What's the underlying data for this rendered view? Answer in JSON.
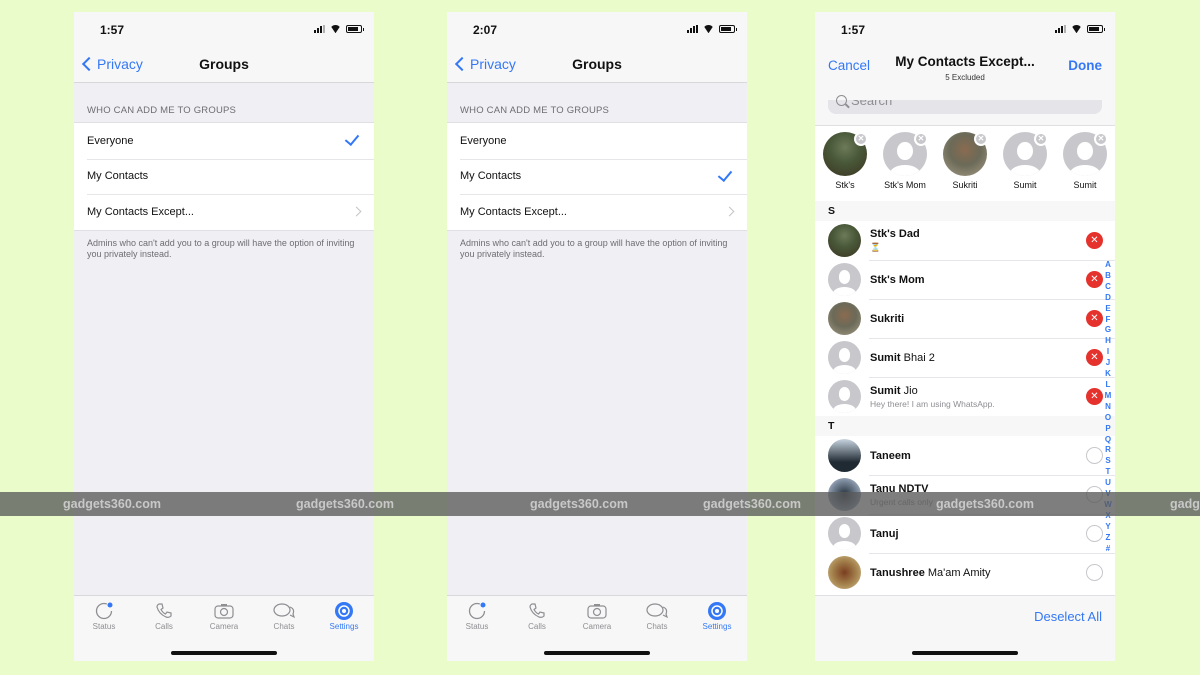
{
  "colors": {
    "background": "#e9fcc9",
    "accent": "#3478f6",
    "remove": "#e5322d"
  },
  "screens": [
    {
      "status_time": "1:57",
      "back_label": "Privacy",
      "title": "Groups",
      "section_header": "WHO CAN ADD ME TO GROUPS",
      "options": [
        {
          "label": "Everyone",
          "selected": true
        },
        {
          "label": "My Contacts",
          "selected": false
        },
        {
          "label": "My Contacts Except...",
          "disclosure": true
        }
      ],
      "footnote": "Admins who can't add you to a group will have the option of inviting you privately instead.",
      "tabs": [
        {
          "label": "Status",
          "icon": "status-icon"
        },
        {
          "label": "Calls",
          "icon": "phone-icon"
        },
        {
          "label": "Camera",
          "icon": "camera-icon"
        },
        {
          "label": "Chats",
          "icon": "chat-bubbles-icon"
        },
        {
          "label": "Settings",
          "icon": "gear-icon",
          "active": true
        }
      ]
    },
    {
      "status_time": "2:07",
      "back_label": "Privacy",
      "title": "Groups",
      "section_header": "WHO CAN ADD ME TO GROUPS",
      "options": [
        {
          "label": "Everyone",
          "selected": false
        },
        {
          "label": "My Contacts",
          "selected": true
        },
        {
          "label": "My Contacts Except...",
          "disclosure": true
        }
      ],
      "footnote": "Admins who can't add you to a group will have the option of inviting you privately instead.",
      "tabs": [
        {
          "label": "Status",
          "icon": "status-icon"
        },
        {
          "label": "Calls",
          "icon": "phone-icon"
        },
        {
          "label": "Camera",
          "icon": "camera-icon"
        },
        {
          "label": "Chats",
          "icon": "chat-bubbles-icon"
        },
        {
          "label": "Settings",
          "icon": "gear-icon",
          "active": true
        }
      ]
    }
  ],
  "picker": {
    "status_time": "1:57",
    "cancel_label": "Cancel",
    "done_label": "Done",
    "title": "My Contacts Except...",
    "subtitle": "5 Excluded",
    "search_placeholder": "Search",
    "selected": [
      {
        "name": "Stk's"
      },
      {
        "name": "Stk's Mom"
      },
      {
        "name": "Sukriti"
      },
      {
        "name": "Sumit"
      },
      {
        "name": "Sumit"
      }
    ],
    "sections": [
      {
        "letter": "S",
        "contacts": [
          {
            "first": "Stk's Dad",
            "rest": "",
            "status": "⏳",
            "excluded": true
          },
          {
            "first": "Stk's Mom",
            "rest": "",
            "status": "",
            "excluded": true
          },
          {
            "first": "Sukriti",
            "rest": "",
            "status": "",
            "excluded": true
          },
          {
            "first": "Sumit",
            "rest": " Bhai 2",
            "status": "",
            "excluded": true
          },
          {
            "first": "Sumit",
            "rest": " Jio",
            "status": "Hey there! I am using WhatsApp.",
            "excluded": true
          }
        ]
      },
      {
        "letter": "T",
        "contacts": [
          {
            "first": "Taneem",
            "rest": "",
            "status": "",
            "excluded": false
          },
          {
            "first": "Tanu NDTV",
            "rest": "",
            "status": "Urgent calls only",
            "excluded": false
          },
          {
            "first": "Tanuj",
            "rest": "",
            "status": "",
            "excluded": false
          },
          {
            "first": "Tanushree",
            "rest": " Ma'am Amity",
            "status": "",
            "excluded": false
          }
        ]
      }
    ],
    "index_letters": [
      "A",
      "B",
      "C",
      "D",
      "E",
      "F",
      "G",
      "H",
      "I",
      "J",
      "K",
      "L",
      "M",
      "N",
      "O",
      "P",
      "Q",
      "R",
      "S",
      "T",
      "U",
      "V",
      "W",
      "X",
      "Y",
      "Z",
      "#"
    ],
    "deselect_label": "Deselect All"
  },
  "watermark": "gadgets360.com"
}
